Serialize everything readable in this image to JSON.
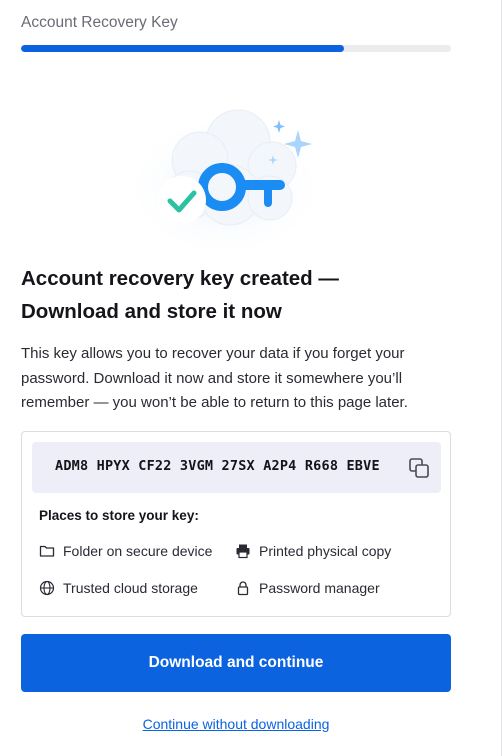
{
  "header": {
    "step_title": "Account Recovery Key",
    "progress_fraction": 0.75
  },
  "colors": {
    "accent": "#0b63e0",
    "check": "#2ac3a2",
    "key_box_bg": "#eeeef9"
  },
  "hero": {
    "icons": [
      "cloud-illustration",
      "key-icon",
      "checkmark-icon",
      "sparkle-icon"
    ]
  },
  "main": {
    "heading_line1": "Account recovery key created —",
    "heading_line2": "Download and store it now",
    "description": "This key allows you to recover your data if you forget your password. Download it now and store it somewhere you’ll remember — you won’t be able to return to this page later."
  },
  "key_card": {
    "recovery_key": "ADM8 HPYX CF22 3VGM 27SX A2P4 R668 EBVE",
    "copy_icon": "copy-icon",
    "places_title": "Places to store your key:",
    "places": [
      {
        "label": "Folder on secure device",
        "icon": "folder-icon"
      },
      {
        "label": "Printed physical copy",
        "icon": "printer-icon"
      },
      {
        "label": "Trusted cloud storage",
        "icon": "globe-icon"
      },
      {
        "label": "Password manager",
        "icon": "lock-icon"
      }
    ]
  },
  "actions": {
    "primary_label": "Download and continue",
    "skip_label": "Continue without downloading"
  }
}
